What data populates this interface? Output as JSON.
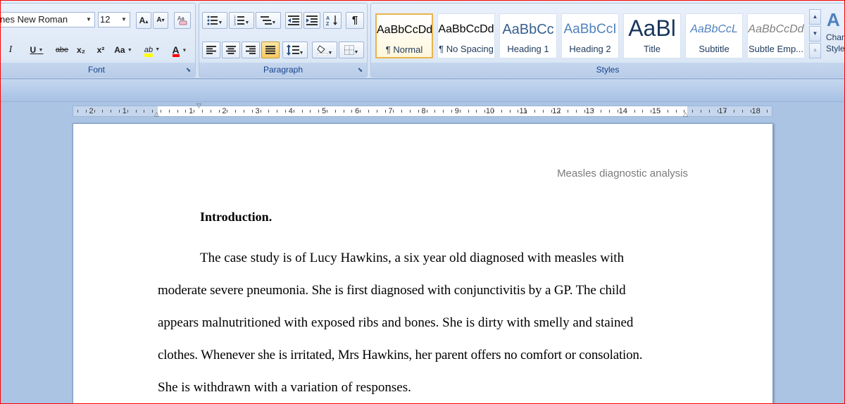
{
  "font_group": {
    "label": "Font",
    "font_name": "nes New Roman",
    "font_size": "12",
    "grow_font": "A",
    "shrink_font": "A",
    "clear_format_icon": "clear-formatting-icon",
    "italic": "I",
    "underline": "U",
    "strikethrough": "abe",
    "subscript": "x₂",
    "superscript": "x²",
    "change_case": "Aa",
    "highlight_label": "ab",
    "font_color_label": "A",
    "colors": {
      "highlight": "#ffff00",
      "font_color": "#ff0000"
    }
  },
  "paragraph_group": {
    "label": "Paragraph"
  },
  "styles_group": {
    "label": "Styles",
    "styles": [
      {
        "preview": "AaBbCcDd",
        "name": "¶ Normal"
      },
      {
        "preview": "AaBbCcDd",
        "name": "¶ No Spacing"
      },
      {
        "preview": "AaBbCc",
        "name": "Heading 1"
      },
      {
        "preview": "AaBbCcI",
        "name": "Heading 2"
      },
      {
        "preview": "AaBl",
        "name": "Title"
      },
      {
        "preview": "AaBbCcL",
        "name": "Subtitle"
      },
      {
        "preview": "AaBbCcDd",
        "name": "Subtle Emp..."
      }
    ],
    "change_styles": [
      "Chan",
      "Style"
    ]
  },
  "ruler": {
    "left_labels": [
      "2",
      "1"
    ],
    "right_labels": [
      "1",
      "2",
      "3",
      "4",
      "5",
      "6",
      "7",
      "8",
      "9",
      "10",
      "11",
      "12",
      "13",
      "14",
      "15",
      "17",
      "18"
    ]
  },
  "document": {
    "header": "Measles diagnostic analysis",
    "heading": "Introduction.",
    "lines": [
      "The case study is of Lucy Hawkins, a six year old diagnosed with measles with",
      "moderate severe pneumonia. She is first diagnosed with conjunctivitis by a GP.  The child",
      "appears malnutritioned with exposed ribs and bones. She is dirty with smelly and stained",
      "clothes. Whenever she is irritated, Mrs Hawkins, her parent offers no comfort or consolation.",
      "She is withdrawn with a variation of responses."
    ]
  }
}
